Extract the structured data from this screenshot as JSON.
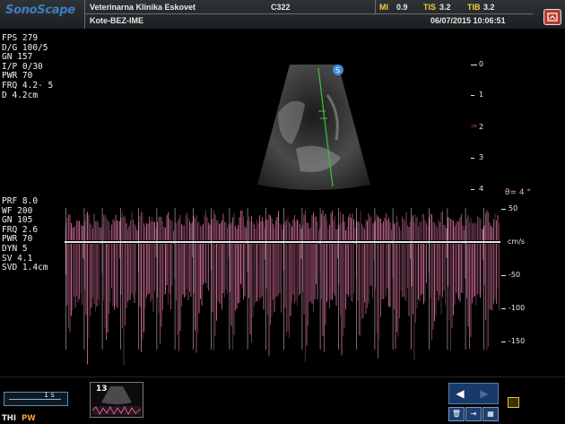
{
  "header": {
    "brand": "SonoScape",
    "clinic": "Veterinarna Klinika Eskovet",
    "patient": "Kote-BEZ-IME",
    "probe": "C322",
    "mi_label": "MI",
    "mi_value": "0.9",
    "tis_label": "TIS",
    "tis_value": "3.2",
    "tib_label": "TIB",
    "tib_value": "3.2",
    "datetime": "06/07/2015 10:06:51"
  },
  "b_mode_params": [
    "FPS 279",
    "D/G 100/5",
    "GN  157",
    "I/P  0/30",
    "PWR 70",
    "FRQ 4.2- 5",
    "D   4.2cm"
  ],
  "pw_params": [
    "PRF 8.0",
    "WF  200",
    "GN  105",
    "FRQ 2.6",
    "PWR 70",
    "DYN 5",
    "SV  4.1",
    "SVD 1.4cm"
  ],
  "depth_scale": [
    "0",
    "1",
    "2",
    "3",
    "4"
  ],
  "focus_marker": "2",
  "velocity_scale": {
    "top": "50",
    "unit": "cm/s",
    "ticks": [
      "-50",
      "-100",
      "-150"
    ]
  },
  "theta": "θ= 4 °",
  "footer": {
    "time_scale": "1 s",
    "thumb_count": "13",
    "thi_label": "THI",
    "pw_label": "PW",
    "icons": [
      "back-icon",
      "forward-icon",
      "trash-icon",
      "export-icon",
      "grid-icon",
      "small-square-icon"
    ]
  },
  "colors": {
    "brand": "#3e7dbf",
    "doppler": "#e87aa8",
    "header_yellow": "#f0d23a",
    "pw_orange": "#ff9d3b"
  }
}
